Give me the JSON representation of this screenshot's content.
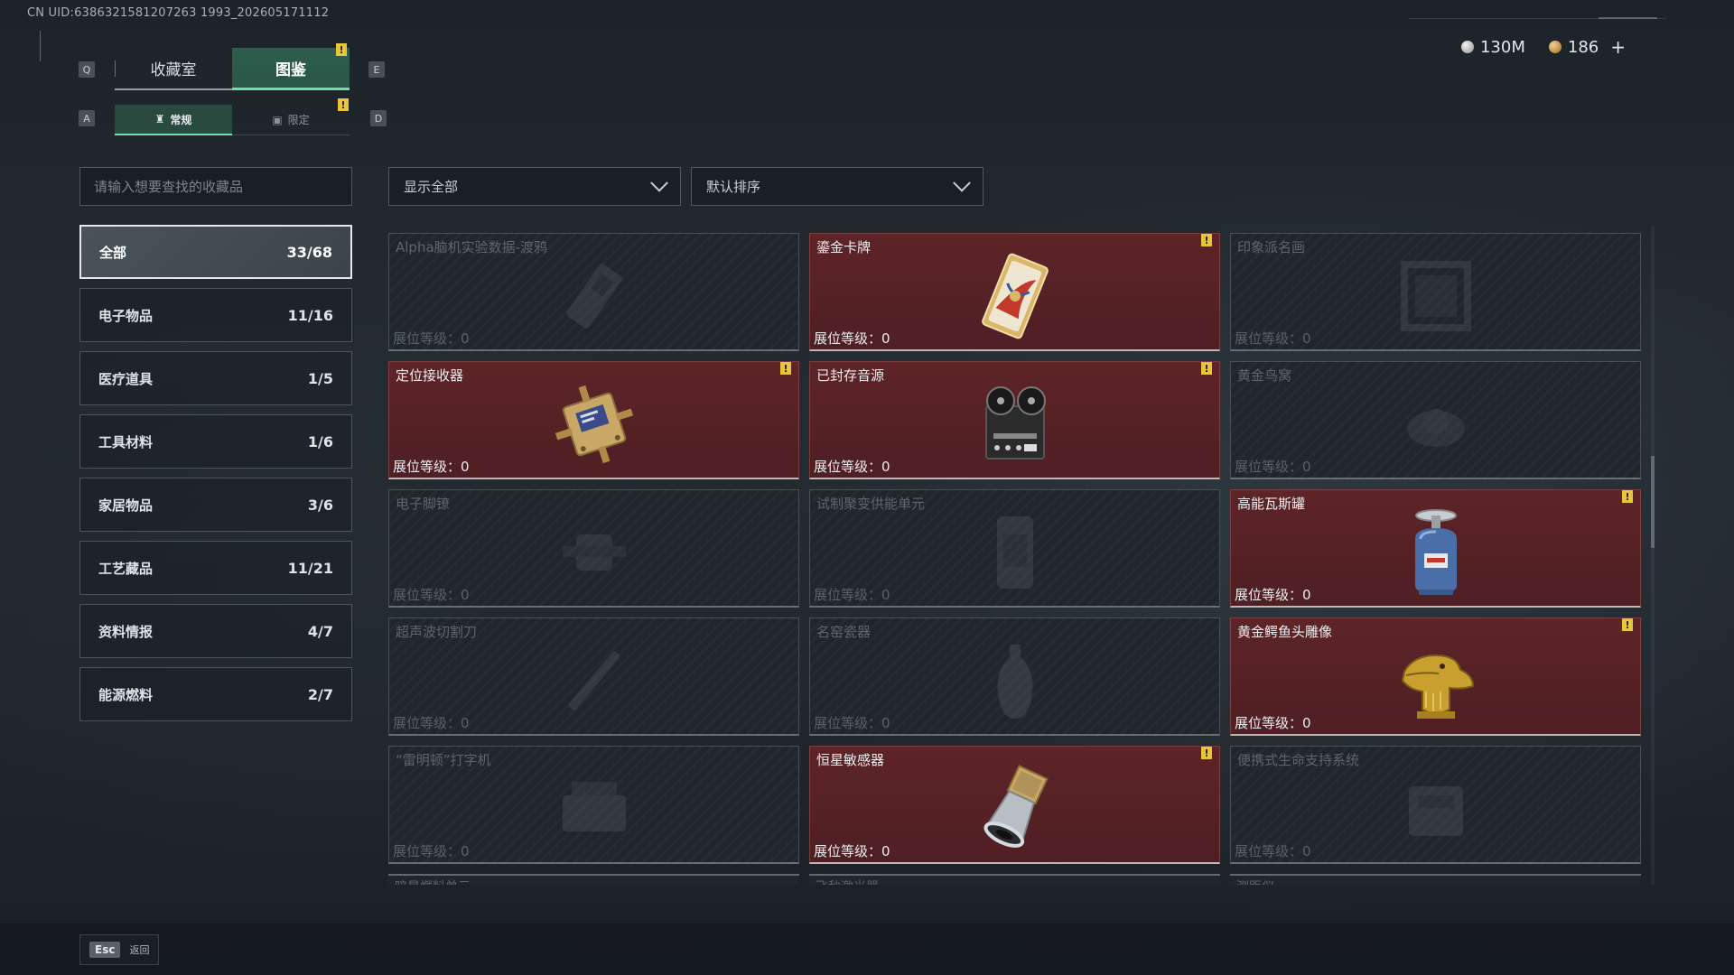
{
  "uid_text": "CN UID:6386321581207263 1993_202605171112",
  "currency": {
    "silver": "130M",
    "gold": "186",
    "plus": "+"
  },
  "keys": {
    "q": "Q",
    "e": "E",
    "a": "A",
    "d": "D"
  },
  "main_tabs": [
    {
      "label": "收藏室"
    },
    {
      "label": "图鉴"
    }
  ],
  "sub_tabs": [
    {
      "label": "常规"
    },
    {
      "label": "限定"
    }
  ],
  "search": {
    "placeholder": "请输入想要查找的收藏品"
  },
  "filter": {
    "selected": "显示全部"
  },
  "sort": {
    "selected": "默认排序"
  },
  "categories": [
    {
      "label": "全部",
      "count": "33/68"
    },
    {
      "label": "电子物品",
      "count": "11/16"
    },
    {
      "label": "医疗道具",
      "count": "1/5"
    },
    {
      "label": "工具材料",
      "count": "1/6"
    },
    {
      "label": "家居物品",
      "count": "3/6"
    },
    {
      "label": "工艺藏品",
      "count": "11/21"
    },
    {
      "label": "资料情报",
      "count": "4/7"
    },
    {
      "label": "能源燃料",
      "count": "2/7"
    }
  ],
  "cards": [
    {
      "name": "Alpha脑机实验数据-渡鸦",
      "level": "展位等级：0",
      "owned": false,
      "icon": "brain-chip-icon"
    },
    {
      "name": "鎏金卡牌",
      "level": "展位等级：0",
      "owned": true,
      "icon": "gilded-card-icon"
    },
    {
      "name": "印象派名画",
      "level": "展位等级：0",
      "owned": false,
      "icon": "painting-icon"
    },
    {
      "name": "定位接收器",
      "level": "展位等级：0",
      "owned": true,
      "icon": "receiver-icon"
    },
    {
      "name": "已封存音源",
      "level": "展位等级：0",
      "owned": true,
      "icon": "reel-recorder-icon"
    },
    {
      "name": "黄金鸟窝",
      "level": "展位等级：0",
      "owned": false,
      "icon": "bird-nest-icon"
    },
    {
      "name": "电子脚镣",
      "level": "展位等级：0",
      "owned": false,
      "icon": "ankle-monitor-icon"
    },
    {
      "name": "试制聚变供能单元",
      "level": "展位等级：0",
      "owned": false,
      "icon": "fusion-cell-icon"
    },
    {
      "name": "高能瓦斯罐",
      "level": "展位等级：0",
      "owned": true,
      "icon": "gas-canister-icon"
    },
    {
      "name": "超声波切割刀",
      "level": "展位等级：0",
      "owned": false,
      "icon": "ultrasonic-knife-icon"
    },
    {
      "name": "名窑瓷器",
      "level": "展位等级：0",
      "owned": false,
      "icon": "porcelain-vase-icon"
    },
    {
      "name": "黄金鳄鱼头雕像",
      "level": "展位等级：0",
      "owned": true,
      "icon": "golden-crocodile-icon"
    },
    {
      "name": "“雷明顿”打字机",
      "level": "展位等级：0",
      "owned": false,
      "icon": "typewriter-icon"
    },
    {
      "name": "恒星敏感器",
      "level": "展位等级：0",
      "owned": true,
      "icon": "star-sensor-icon"
    },
    {
      "name": "便携式生命支持系统",
      "level": "展位等级：0",
      "owned": false,
      "icon": "life-support-icon"
    }
  ],
  "peek_cards": [
    {
      "name": "暗星燃料单元"
    },
    {
      "name": "飞秒激光器"
    },
    {
      "name": "测距仪"
    }
  ],
  "footer": {
    "esc_key": "Esc",
    "esc_label": "返回"
  },
  "colors": {
    "accent": "#6ee0a8",
    "owned_card": "#5e2428",
    "warning": "#e8c53a"
  }
}
